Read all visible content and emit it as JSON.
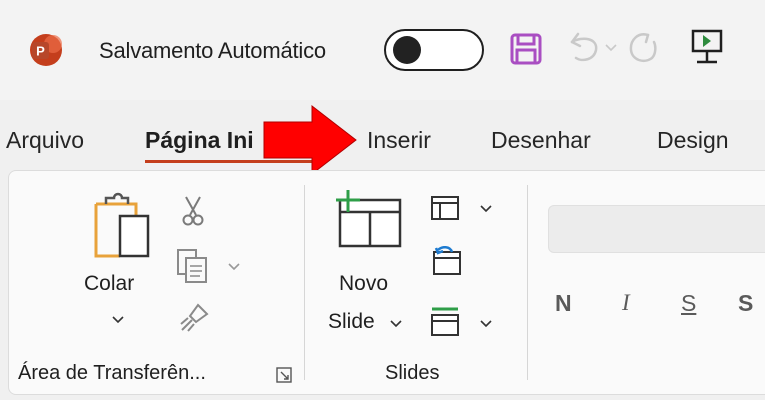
{
  "titlebar": {
    "app_icon_letter": "P",
    "autosave_label": "Salvamento Automático",
    "accent": "#c43e1c",
    "save_color": "#a94ec2"
  },
  "tabs": [
    {
      "label": "Arquivo",
      "active": false
    },
    {
      "label": "Página Ini",
      "active": true
    },
    {
      "label": "Inserir",
      "active": false
    },
    {
      "label": "Desenhar",
      "active": false
    },
    {
      "label": "Design",
      "active": false
    }
  ],
  "ribbon": {
    "clipboard": {
      "paste_label": "Colar",
      "group_label": "Área de Transferên..."
    },
    "slides": {
      "new_slide_line1": "Novo",
      "new_slide_line2": "Slide",
      "group_label": "Slides"
    },
    "font": {
      "bold_label": "N",
      "italic_label": "I",
      "underline_label": "S",
      "strike_label": "S"
    }
  },
  "annotation": {
    "arrow_color": "#ff0000"
  }
}
